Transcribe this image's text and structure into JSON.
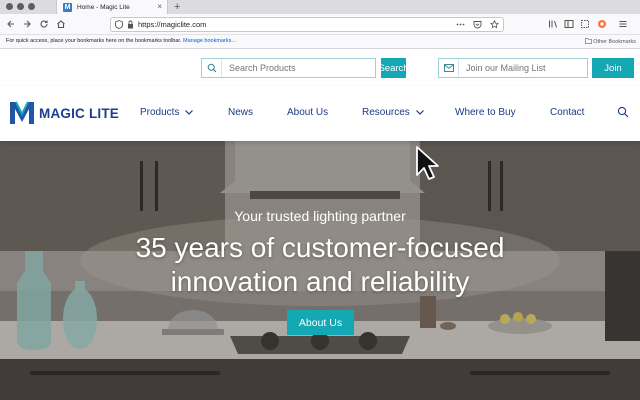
{
  "browser": {
    "tab_title": "Home - Magic Lite",
    "tab_favicon": "M",
    "new_tab": "+",
    "close_tab": "×",
    "url": "https://magiclite.com",
    "bookmarks_hint": "For quick access, place your bookmarks here on the bookmarks toolbar.",
    "bookmarks_link": "Manage bookmarks...",
    "other_bookmarks": "Other Bookmarks",
    "icons": [
      "back-icon",
      "forward-icon",
      "reload-icon",
      "home-icon",
      "shield-icon",
      "lock-icon",
      "pocket-icon",
      "star-icon",
      "library-icon",
      "sidebar-icon",
      "profile-icon",
      "menu-icon"
    ]
  },
  "site": {
    "search": {
      "placeholder": "Search Products",
      "button": "Search"
    },
    "mailing": {
      "placeholder": "Join our Mailing List",
      "button": "Join"
    },
    "logo_text": "MAGIC LITE",
    "nav": [
      {
        "label": "Products",
        "dropdown": true
      },
      {
        "label": "News",
        "dropdown": false
      },
      {
        "label": "About Us",
        "dropdown": false
      },
      {
        "label": "Resources",
        "dropdown": true
      },
      {
        "label": "Where to Buy",
        "dropdown": false
      },
      {
        "label": "Contact",
        "dropdown": false
      }
    ],
    "hero": {
      "tagline": "Your trusted lighting partner",
      "headline_line1": "35 years of customer-focused",
      "headline_line2": "innovation and reliability",
      "cta": "About Us"
    }
  },
  "colors": {
    "accent": "#14a8b5",
    "brand_navy": "#1d3a87"
  }
}
